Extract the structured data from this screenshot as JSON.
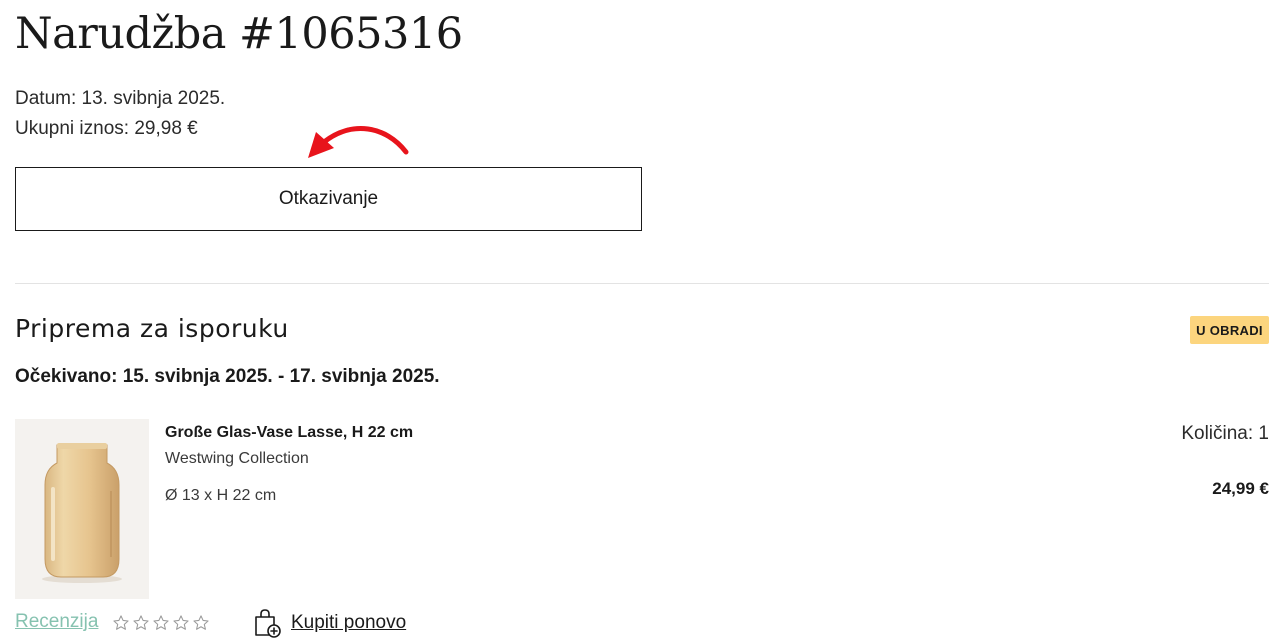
{
  "order": {
    "title": "Narudžba #1065316",
    "date_text": "Datum: 13. svibnja 2025.",
    "total_text": "Ukupni iznos: 29,98 €",
    "cancel_label": "Otkazivanje"
  },
  "shipment": {
    "title": "Priprema za isporuku",
    "status_badge": "U OBRADI",
    "expected_text": "Očekivano: 15. svibnja 2025. - 17. svibnja 2025."
  },
  "item": {
    "name": "Große Glas-Vase Lasse, H 22 cm",
    "brand": "Westwing Collection",
    "dimensions": "Ø 13 x H 22 cm",
    "quantity_text": "Količina: 1",
    "price": "24,99 €",
    "image_icon": "amber-glass-vase-image"
  },
  "actions": {
    "review_label": "Recenzija",
    "rating_max": 5,
    "rating_value": 0,
    "rebuy_label": "Kupiti ponovo",
    "rebuy_icon": "bag-plus-icon"
  },
  "colors": {
    "badge": "#fcd57e",
    "review_link": "#86c2b0",
    "annotation_arrow": "#e8141c"
  }
}
